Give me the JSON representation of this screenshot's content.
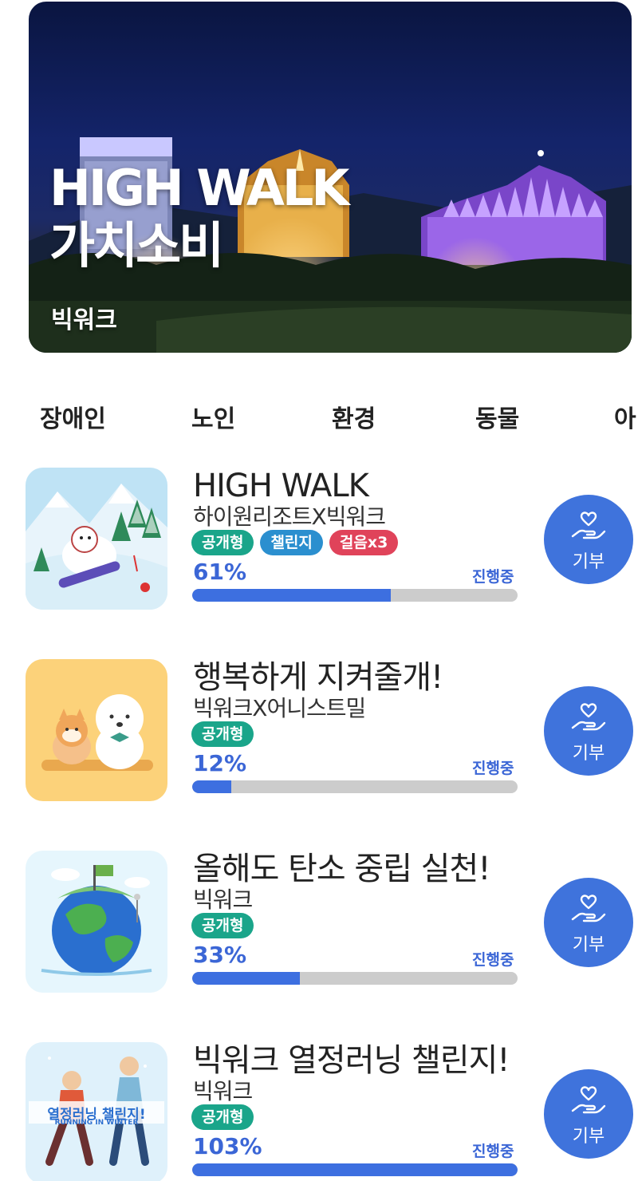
{
  "banner": {
    "title_line1": "HIGH WALK",
    "title_line2": "가치소비",
    "subtitle": "빅워크"
  },
  "tabs": [
    "장애인",
    "노인",
    "환경",
    "동물",
    "아"
  ],
  "status_color": "#3b66d6",
  "badge_colors": {
    "public": "#1aa58a",
    "challenge": "#2b8fcf",
    "steps": "#e0435a"
  },
  "campaigns": [
    {
      "title": "HIGH WALK",
      "org": "하이원리조트X빅워크",
      "badges": [
        "공개형",
        "챌린지",
        "걸음x3"
      ],
      "percent": "61%",
      "progress": 0.61,
      "status": "진행중",
      "donate_label": "기부",
      "thumb_icon": "snowboard-dog-icon"
    },
    {
      "title": "행복하게 지켜줄개!",
      "org": "빅워크X어니스트밀",
      "badges": [
        "공개형"
      ],
      "percent": "12%",
      "progress": 0.12,
      "status": "진행중",
      "donate_label": "기부",
      "thumb_icon": "cat-and-dog-icon"
    },
    {
      "title": "올해도 탄소 중립 실천!",
      "org": "빅워크",
      "badges": [
        "공개형"
      ],
      "percent": "33%",
      "progress": 0.33,
      "status": "진행중",
      "donate_label": "기부",
      "thumb_icon": "green-earth-icon"
    },
    {
      "title": "빅워크 열정러닝 챌린지!",
      "org": "빅워크",
      "badges": [
        "공개형"
      ],
      "percent": "103%",
      "progress": 1.0,
      "status": "진행중",
      "donate_label": "기부",
      "thumb_icon": "winter-running-icon",
      "thumb_text_main": "열정러닝 챌린지!",
      "thumb_text_sub": "RUNNING IN WINTER"
    }
  ]
}
